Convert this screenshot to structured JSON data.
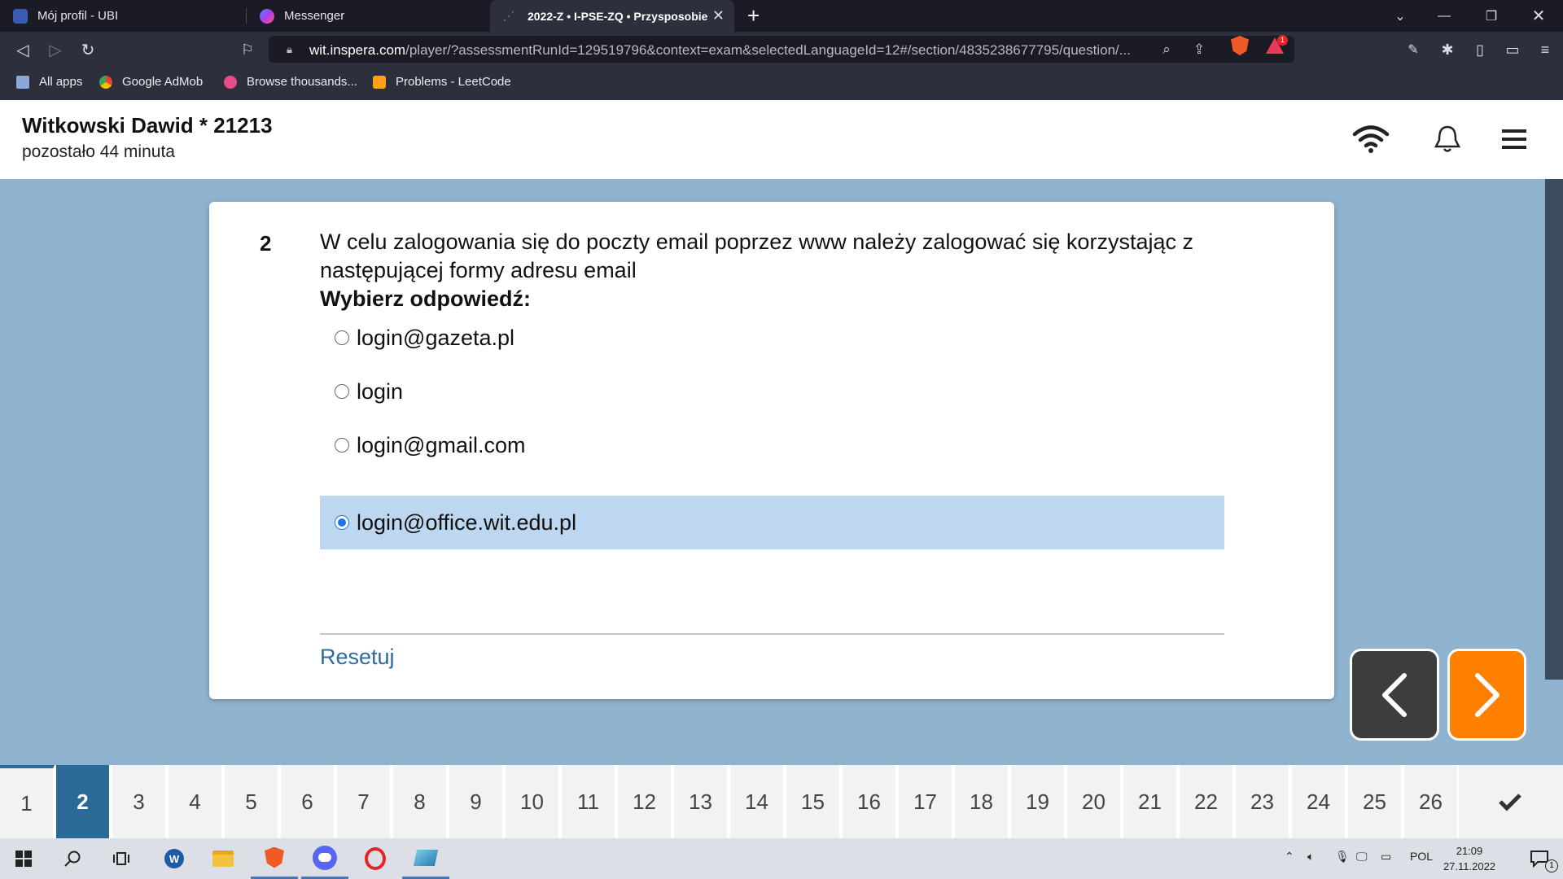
{
  "browser": {
    "tabs": [
      {
        "label": "Mój profil - UBI",
        "icon": "graduation-cap-icon"
      },
      {
        "label": "Messenger",
        "icon": "messenger-icon"
      },
      {
        "label": "2022-Z • I-PSE-ZQ • Przysposobie",
        "icon": "inspera-icon"
      }
    ],
    "url_host": "wit.inspera.com",
    "url_path": "/player/?assessmentRunId=129519796&context=exam&selectedLanguageId=12#/section/4835238677795/question/...",
    "rewards_badge": "1",
    "bookmarks": [
      {
        "label": "All apps",
        "icon": "apps-icon"
      },
      {
        "label": "Google AdMob",
        "icon": "admob-icon"
      },
      {
        "label": "Browse thousands...",
        "icon": "dribbble-icon"
      },
      {
        "label": "Problems - LeetCode",
        "icon": "leetcode-icon"
      }
    ]
  },
  "header": {
    "student": "Witkowski Dawid * 21213",
    "time_left": "pozostało 44 minuta"
  },
  "question": {
    "number": "2",
    "text": "W celu zalogowania się do poczty email poprzez www należy zalogować się korzystając z następującej formy adresu email",
    "prompt": "Wybierz odpowiedź:",
    "options": [
      {
        "label": "login@gazeta.pl",
        "selected": false
      },
      {
        "label": "login",
        "selected": false
      },
      {
        "label": "login@gmail.com",
        "selected": false
      },
      {
        "label": "login@office.wit.edu.pl",
        "selected": true
      }
    ],
    "reset_label": "Resetuj"
  },
  "navigation": {
    "questions": [
      "1",
      "2",
      "3",
      "4",
      "5",
      "6",
      "7",
      "8",
      "9",
      "10",
      "11",
      "12",
      "13",
      "14",
      "15",
      "16",
      "17",
      "18",
      "19",
      "20",
      "21",
      "22",
      "23",
      "24",
      "25",
      "26"
    ],
    "current": "2"
  },
  "taskbar": {
    "language": "POL",
    "time": "21:09",
    "date": "27.11.2022",
    "notification_count": "1"
  },
  "colors": {
    "accent_blue": "#2b6a96",
    "next_orange": "#ff7f00",
    "selected_bg": "#bcd7ef",
    "page_bg": "#8fb3cf"
  }
}
